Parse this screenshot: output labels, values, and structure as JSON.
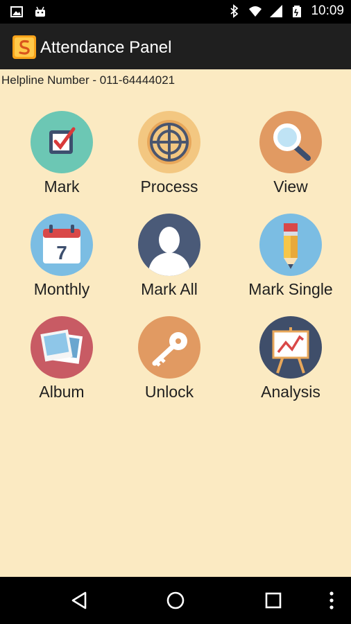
{
  "status_bar": {
    "time": "10:09",
    "left_icons": [
      "image-icon",
      "android-icon"
    ],
    "right_icons": [
      "bluetooth-icon",
      "wifi-icon",
      "signal-icon",
      "battery-icon"
    ]
  },
  "app_bar": {
    "title": "Attendance Panel",
    "logo": "app-logo-icon"
  },
  "helpline": "Helpline Number - 011-64444021",
  "tiles": [
    {
      "label": "Mark",
      "icon": "mark-checkbox-icon",
      "color": "#6cc7b4"
    },
    {
      "label": "Process",
      "icon": "process-target-icon",
      "color": "#f3c781"
    },
    {
      "label": "View",
      "icon": "view-search-icon",
      "color": "#e19a62"
    },
    {
      "label": "Monthly",
      "icon": "monthly-calendar-icon",
      "color": "#7bbde3"
    },
    {
      "label": "Mark All",
      "icon": "mark-all-user-icon",
      "color": "#4a5a78"
    },
    {
      "label": "Mark Single",
      "icon": "mark-single-pencil-icon",
      "color": "#7bbde3"
    },
    {
      "label": "Album",
      "icon": "album-photos-icon",
      "color": "#c85b64"
    },
    {
      "label": "Unlock",
      "icon": "unlock-key-icon",
      "color": "#e19a62"
    },
    {
      "label": "Analysis",
      "icon": "analysis-chart-icon",
      "color": "#3f4e6a"
    }
  ],
  "nav_bar": {
    "buttons": [
      "back-icon",
      "home-icon",
      "recents-icon",
      "menu-icon"
    ]
  }
}
